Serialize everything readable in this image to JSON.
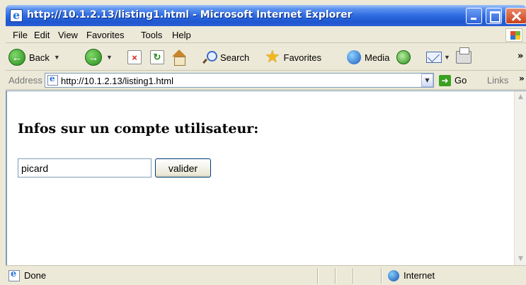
{
  "window": {
    "title": "http://10.1.2.13/listing1.html - Microsoft Internet Explorer"
  },
  "menu": {
    "items": [
      "File",
      "Edit",
      "View",
      "Favorites",
      "Tools",
      "Help"
    ]
  },
  "toolbar": {
    "back_label": "Back",
    "search_label": "Search",
    "favorites_label": "Favorites",
    "media_label": "Media",
    "overflow": "»"
  },
  "address": {
    "label": "Address",
    "url": "http://10.1.2.13/listing1.html",
    "go_label": "Go",
    "links_label": "Links",
    "links_overflow": "»"
  },
  "page": {
    "heading": "Infos sur un compte utilisateur:",
    "input_value": "picard",
    "button_label": "valider"
  },
  "status": {
    "text": "Done",
    "zone": "Internet"
  }
}
